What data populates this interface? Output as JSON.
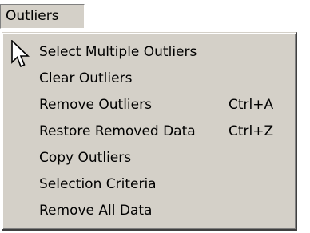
{
  "menu": {
    "title": "Outliers",
    "items": [
      {
        "label": "Select Multiple Outliers",
        "shortcut": ""
      },
      {
        "label": "Clear Outliers",
        "shortcut": ""
      },
      {
        "label": "Remove Outliers",
        "shortcut": "Ctrl+A"
      },
      {
        "label": "Restore Removed Data",
        "shortcut": "Ctrl+Z"
      },
      {
        "label": "Copy Outliers",
        "shortcut": ""
      },
      {
        "label": "Selection Criteria",
        "shortcut": ""
      },
      {
        "label": "Remove All Data",
        "shortcut": ""
      }
    ]
  },
  "cursor": {
    "icon": "mouse-pointer-icon"
  },
  "colors": {
    "menu_face": "#d4d0c8",
    "text": "#000000",
    "shadow": "#808080",
    "dark_shadow": "#404040",
    "highlight": "#ffffff"
  }
}
